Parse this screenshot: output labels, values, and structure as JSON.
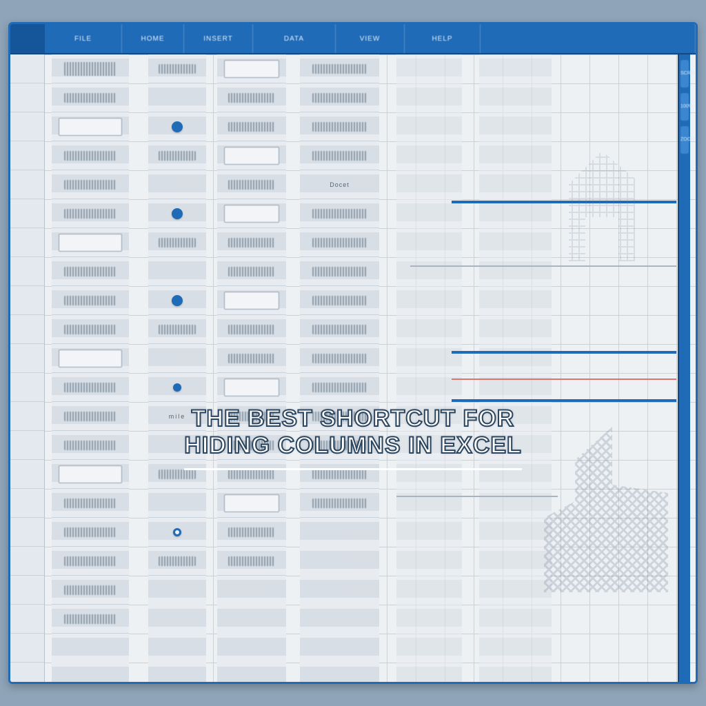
{
  "title_line1": "The Best Shortcut For",
  "title_line2": "Hiding Columns in Excel",
  "header": {
    "cols": [
      "",
      "FILE",
      "HOME",
      "INSERT",
      "DATA",
      "VIEW",
      "HELP",
      "",
      ""
    ]
  },
  "rail": [
    "SCROLL",
    "100%",
    "ZOOM"
  ],
  "bullets_label": "mile",
  "decor_label": "Docet"
}
